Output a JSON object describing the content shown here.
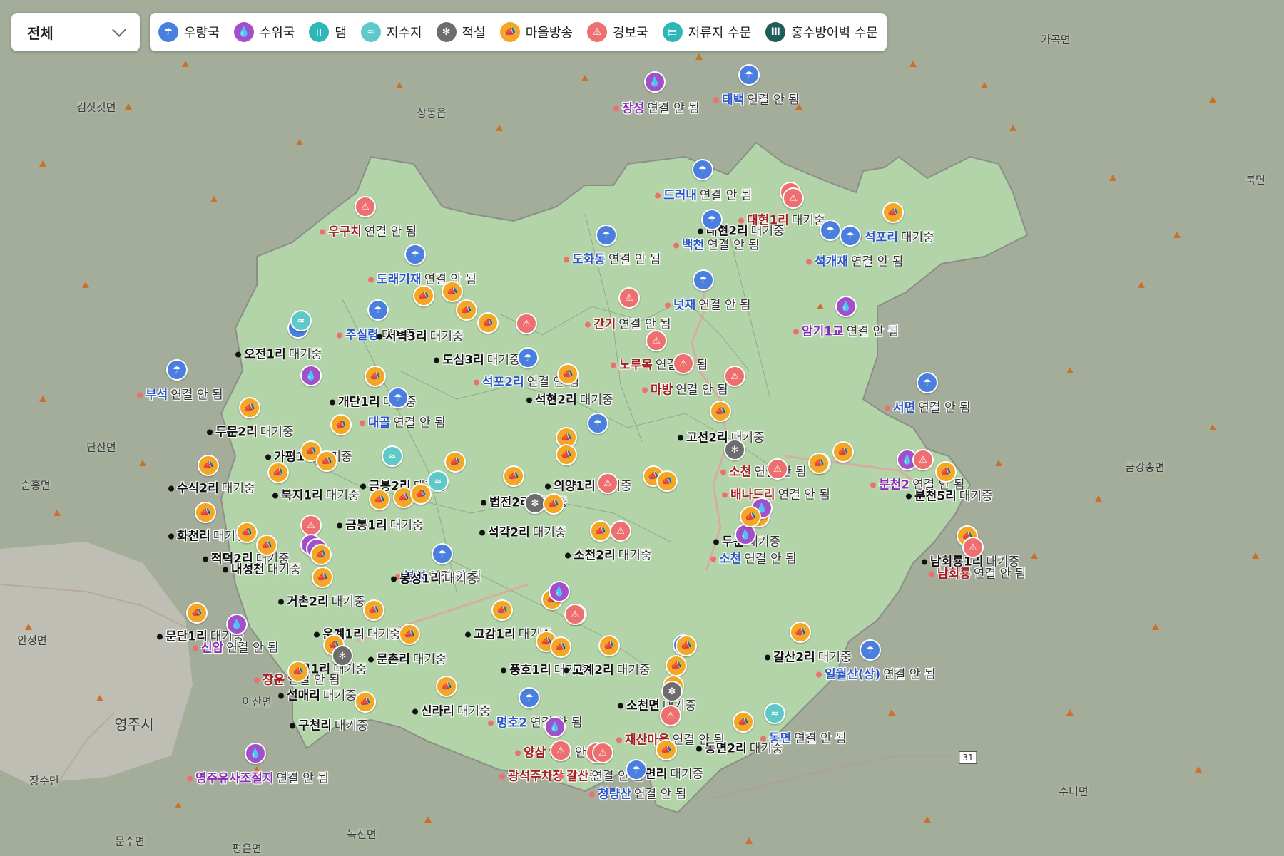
{
  "filter": {
    "selected": "전체"
  },
  "legend": [
    {
      "key": "rain",
      "label": "우량국",
      "color": "#4a7fe0",
      "icon": "umbrella-icon",
      "glyph": "☂"
    },
    {
      "key": "water",
      "label": "수위국",
      "color": "#a34fc9",
      "icon": "water-drop-icon",
      "glyph": "💧"
    },
    {
      "key": "dam",
      "label": "댐",
      "color": "#2fb6b6",
      "icon": "dam-icon",
      "glyph": "▯"
    },
    {
      "key": "res",
      "label": "저수지",
      "color": "#5ec9c9",
      "icon": "wave-icon",
      "glyph": "≈"
    },
    {
      "key": "snow",
      "label": "적설",
      "color": "#6d6d6d",
      "icon": "snowflake-icon",
      "glyph": "✻"
    },
    {
      "key": "bc",
      "label": "마을방송",
      "color": "#f5a623",
      "icon": "megaphone-icon",
      "glyph": "📣"
    },
    {
      "key": "warn",
      "label": "경보국",
      "color": "#ee6f6f",
      "icon": "warning-icon",
      "glyph": "⚠"
    },
    {
      "key": "gauge",
      "label": "저류지 수문",
      "color": "#2fb6b6",
      "icon": "gauge-icon",
      "glyph": "▤"
    },
    {
      "key": "flood",
      "label": "홍수방어벽 수문",
      "color": "#1f5c5a",
      "icon": "floodwall-icon",
      "glyph": "Ⅲ"
    }
  ],
  "status_text": {
    "disconnected": "연결 안 됨",
    "standby": "대기중"
  },
  "place_names": [
    "가곡면",
    "북면",
    "김삿갓면",
    "상동읍",
    "단산면",
    "순흥면",
    "금강송면",
    "안정면",
    "이산면",
    "영주시",
    "장수면",
    "문수면",
    "평은면",
    "녹전면",
    "수비면"
  ],
  "road_number": "31",
  "stations": [
    {
      "name": "장성",
      "status": "연결 안 됨",
      "type": "water"
    },
    {
      "name": "태백",
      "status": "연결 안 됨",
      "type": "rain"
    },
    {
      "name": "드러내",
      "status": "연결 안 됨",
      "type": "rain"
    },
    {
      "name": "우구치",
      "status": "연결 안 됨",
      "type": "warn"
    },
    {
      "name": "도래기재",
      "status": "연결 안 됨",
      "type": "rain"
    },
    {
      "name": "도화동",
      "status": "연결 안 됨",
      "type": "rain"
    },
    {
      "name": "백천",
      "status": "연결 안 됨",
      "type": "rain"
    },
    {
      "name": "대현2리",
      "status": "대기중",
      "type": "gen"
    },
    {
      "name": "대현1리",
      "status": "대기중",
      "type": "warn"
    },
    {
      "name": "석포리",
      "status": "대기중",
      "type": "rain"
    },
    {
      "name": "석개재",
      "status": "연결 안 됨",
      "type": "rain"
    },
    {
      "name": "넛재",
      "status": "연결 안 됨",
      "type": "rain"
    },
    {
      "name": "간기",
      "status": "연결 안 됨",
      "type": "warn"
    },
    {
      "name": "노루목",
      "status": "연결 안 됨",
      "type": "warn"
    },
    {
      "name": "암기1교",
      "status": "연결 안 됨",
      "type": "water"
    },
    {
      "name": "서면",
      "status": "연결 안 됨",
      "type": "rain"
    },
    {
      "name": "마방",
      "status": "연결 안 됨",
      "type": "warn"
    },
    {
      "name": "부석",
      "status": "연결 안 됨",
      "type": "rain"
    },
    {
      "name": "주실령",
      "status": "대기중",
      "type": "rain"
    },
    {
      "name": "서벽3리",
      "status": "대기중",
      "type": "gen"
    },
    {
      "name": "오전1리",
      "status": "대기중",
      "type": "gen"
    },
    {
      "name": "도심3리",
      "status": "대기중",
      "type": "gen"
    },
    {
      "name": "석포2리",
      "status": "연결 안 됨",
      "type": "rain"
    },
    {
      "name": "석현2리",
      "status": "대기중",
      "type": "gen"
    },
    {
      "name": "대골",
      "status": "연결 안 됨",
      "type": "rain"
    },
    {
      "name": "개단1리",
      "status": "대기중",
      "type": "gen"
    },
    {
      "name": "두문2리",
      "status": "대기중",
      "type": "gen"
    },
    {
      "name": "가평1리",
      "status": "대기중",
      "type": "gen"
    },
    {
      "name": "수식2리",
      "status": "대기중",
      "type": "gen"
    },
    {
      "name": "북지1리",
      "status": "대기중",
      "type": "gen"
    },
    {
      "name": "금봉2리",
      "status": "대기중",
      "type": "gen"
    },
    {
      "name": "법전2리",
      "status": "대기중",
      "type": "gen"
    },
    {
      "name": "의양1리",
      "status": "대기중",
      "type": "gen"
    },
    {
      "name": "고선2리",
      "status": "대기중",
      "type": "gen"
    },
    {
      "name": "소천",
      "status": "연결 안 됨",
      "type": "warn"
    },
    {
      "name": "분천2",
      "status": "연결 안 됨",
      "type": "water"
    },
    {
      "name": "분천5리",
      "status": "대기중",
      "type": "gen"
    },
    {
      "name": "배나드리",
      "status": "연결 안 됨",
      "type": "warn"
    },
    {
      "name": "금봉1리",
      "status": "대기중",
      "type": "gen"
    },
    {
      "name": "화천리",
      "status": "대기중",
      "type": "gen"
    },
    {
      "name": "적덕2리",
      "status": "대기중",
      "type": "gen"
    },
    {
      "name": "내성천",
      "status": "대기중",
      "type": "gen"
    },
    {
      "name": "석각2리",
      "status": "대기중",
      "type": "gen"
    },
    {
      "name": "소천2리",
      "status": "대기중",
      "type": "gen"
    },
    {
      "name": "두문",
      "status": "대기중",
      "type": "gen"
    },
    {
      "name": "소천",
      "status": "연결 안 됨",
      "type": "rain"
    },
    {
      "name": "남회룡1리",
      "status": "대기중",
      "type": "gen"
    },
    {
      "name": "남회룡",
      "status": "연결 안 됨",
      "type": "warn"
    },
    {
      "name": "봉성",
      "status": "연결 안 됨",
      "type": "rain"
    },
    {
      "name": "봉성1리",
      "status": "대기중",
      "type": "gen"
    },
    {
      "name": "거촌2리",
      "status": "대기중",
      "type": "gen"
    },
    {
      "name": "문단1리",
      "status": "대기중",
      "type": "gen"
    },
    {
      "name": "신암",
      "status": "연결 안 됨",
      "type": "water"
    },
    {
      "name": "운계1리",
      "status": "대기중",
      "type": "gen"
    },
    {
      "name": "고감1리",
      "status": "대기중",
      "type": "gen"
    },
    {
      "name": "문촌리",
      "status": "대기중",
      "type": "gen"
    },
    {
      "name": "갈산2리",
      "status": "대기중",
      "type": "gen"
    },
    {
      "name": "일월산(상)",
      "status": "연결 안 됨",
      "type": "rain"
    },
    {
      "name": "곡1리",
      "status": "대기중",
      "type": "gen"
    },
    {
      "name": "장운",
      "status": "연결 안 됨",
      "type": "warn"
    },
    {
      "name": "풍호1리",
      "status": "대기중",
      "type": "gen"
    },
    {
      "name": "고계2리",
      "status": "대기중",
      "type": "gen"
    },
    {
      "name": "설매리",
      "status": "대기중",
      "type": "gen"
    },
    {
      "name": "구천리",
      "status": "대기중",
      "type": "gen"
    },
    {
      "name": "신라리",
      "status": "대기중",
      "type": "gen"
    },
    {
      "name": "명호2",
      "status": "연결 안 됨",
      "type": "rain"
    },
    {
      "name": "소천면",
      "status": "대기중",
      "type": "gen"
    },
    {
      "name": "재산마을",
      "status": "연결 안 됨",
      "type": "warn"
    },
    {
      "name": "동면",
      "status": "연결 안 됨",
      "type": "rain"
    },
    {
      "name": "동면2리",
      "status": "대기중",
      "type": "gen"
    },
    {
      "name": "양삼",
      "status": "연결 안 됨",
      "type": "warn"
    },
    {
      "name": "광석주차장",
      "status": "대기중",
      "type": "warn"
    },
    {
      "name": "갈산",
      "status": "연결 안 됨",
      "type": "warn"
    },
    {
      "name": "면리",
      "status": "대기중",
      "type": "gen"
    },
    {
      "name": "청량산",
      "status": "연결 안 됨",
      "type": "rain"
    },
    {
      "name": "영주유사조절지",
      "status": "연결 안 됨",
      "type": "water"
    }
  ]
}
